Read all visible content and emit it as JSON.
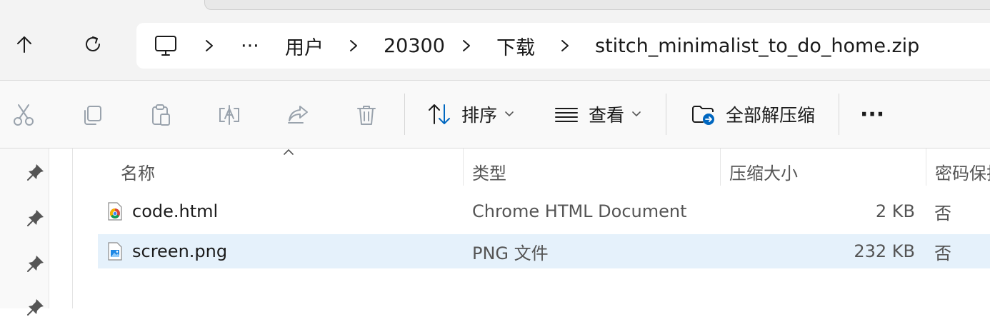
{
  "nav": {
    "up_icon": "arrow-up-icon",
    "refresh_icon": "refresh-icon"
  },
  "address": {
    "root_icon": "monitor-icon",
    "overflow": "···",
    "crumbs": [
      "用户",
      "20300",
      "下载",
      "stitch_minimalist_to_do_home.zip"
    ]
  },
  "toolbar": {
    "icons": [
      "cut-icon",
      "copy-icon",
      "paste-icon",
      "rename-icon",
      "share-icon",
      "delete-icon"
    ],
    "sort_label": "排序",
    "view_label": "查看",
    "extract_label": "全部解压缩",
    "more_label": "···"
  },
  "columns": {
    "name": "名称",
    "type": "类型",
    "size": "压缩大小",
    "protected": "密码保护"
  },
  "files": [
    {
      "name": "code.html",
      "type": "Chrome HTML Document",
      "size": "2 KB",
      "protected": "否",
      "icon": "chrome-html-icon",
      "selected": false
    },
    {
      "name": "screen.png",
      "type": "PNG 文件",
      "size": "232 KB",
      "protected": "否",
      "icon": "png-image-icon",
      "selected": true
    }
  ],
  "colors": {
    "selection": "#e5f1fb",
    "accent": "#0067c0",
    "disabled_icon": "#9aa3ad"
  }
}
